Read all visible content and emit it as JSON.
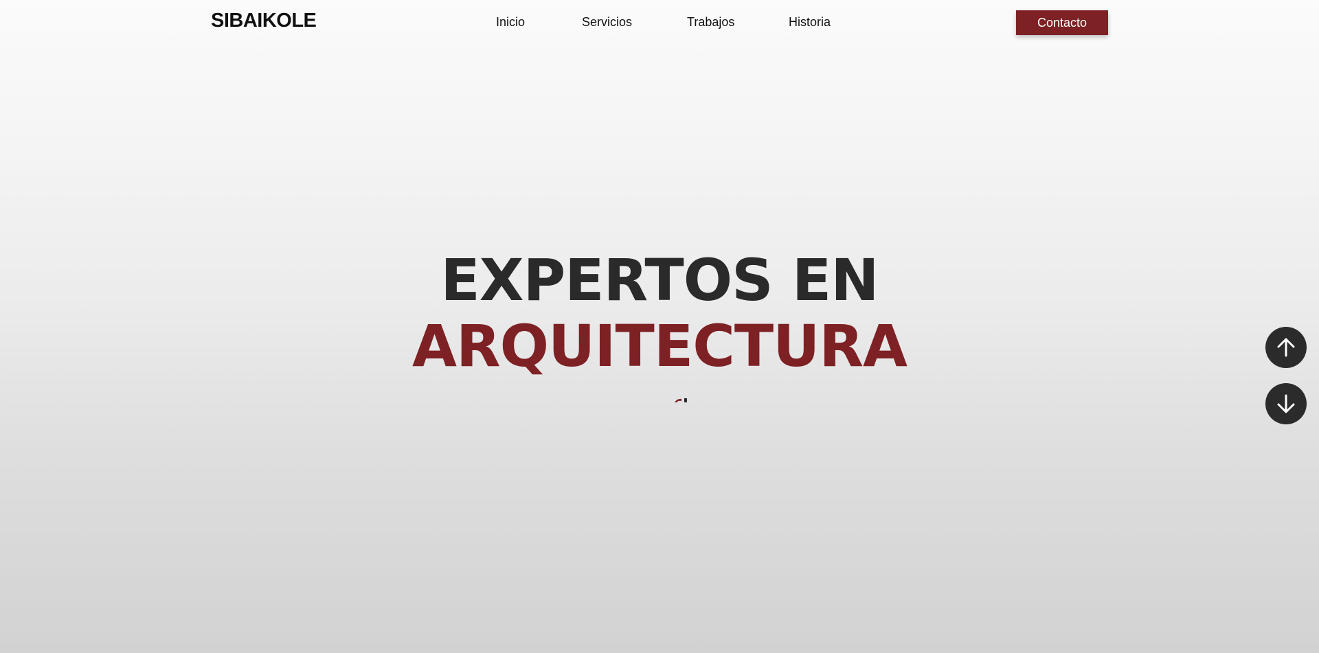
{
  "header": {
    "logo": "SIBAIKOLE",
    "nav": [
      "Inicio",
      "Servicios",
      "Trabajos",
      "Historia"
    ],
    "contact_label": "Contacto"
  },
  "hero": {
    "line1": "EXPERTOS EN",
    "line2": "ARQUITECTURA"
  },
  "colors": {
    "accent": "#7e2124",
    "text_dark": "#2a2a2a",
    "scroll_button": "#2b2b2b"
  },
  "icons": {
    "scroll_up": "arrow-up-icon",
    "scroll_down": "arrow-down-icon"
  }
}
